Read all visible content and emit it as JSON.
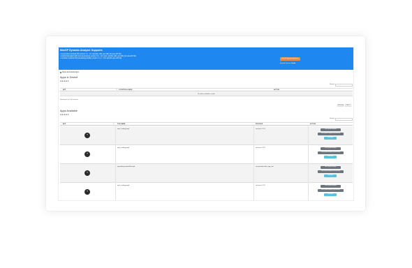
{
  "banner": {
    "title": "MobSF Dynamic Analyzer Supports",
    "lines": [
      "• Genymotion Android VM version 4.1 - 11.0 (arm64, x86, and x86_64 upto API 30)",
      "• Android Emulator AVD (non production) version 5.0 - 11.0 (arm, arm64, x86, and x86_64 upto API 30)",
      "• Corellium Android VM (userdebug builds) version 7.1.2 - 11.0 (arm64 upto API 30)"
    ],
    "button_label": "MobSF Dynamic Analyzer",
    "link_prefix": "Android Dynamic",
    "link_bold": "Guide"
  },
  "package_filter_label": "Show all Android Apps",
  "installed": {
    "title": "Apps in Device",
    "search_label": "Search:",
    "columns": [
      "APP",
      "LOCATION & HASH",
      "ACTION"
    ],
    "empty_text": "No data available in table",
    "info": "Showing 0 to 0 of 0 entries",
    "pager_prev": "Previous",
    "pager_next": "Next"
  },
  "available": {
    "title": "Apps Available",
    "search_label": "Search:",
    "columns": [
      "APP",
      "FILE NAME",
      "PACKAGE",
      "ACTION"
    ],
    "rows": [
      {
        "file": "opal_config.py.apk",
        "package": "com.test.#####",
        "btn1": "Start Dynamic Analysis",
        "btn2": "Start Dynamic Analysis (Instrumented)",
        "btn3": "Test Report"
      },
      {
        "file": "opal_config.py.apk",
        "package": "com.test.#####",
        "btn1": "Start Dynamic Analysis",
        "btn2": "Start Dynamic Analysis (Instrumented)",
        "btn3": "Test Report"
      },
      {
        "file": "app-debug-androidTest.apk",
        "package": "com.yourtest.infra_app_test",
        "btn1": "Start Dynamic Analysis",
        "btn2": "Start Dynamic Analysis (Instrumented)",
        "btn3": "Test Report"
      },
      {
        "file": "opal_config.py.apk",
        "package": "com.test.#####",
        "btn1": "Start Dynamic Analysis",
        "btn2": "Start Dynamic Analysis (Instrumented)",
        "btn3": "Test Report"
      }
    ]
  },
  "colors": {
    "banner": "#1f87f0",
    "banner_button": "#e2904f",
    "action_grey": "#6c757d",
    "action_cyan": "#5bc0de"
  },
  "icons": {
    "app_icon": "app-launcher-icon",
    "rating": "star-icon",
    "sort": "sort-icon"
  }
}
